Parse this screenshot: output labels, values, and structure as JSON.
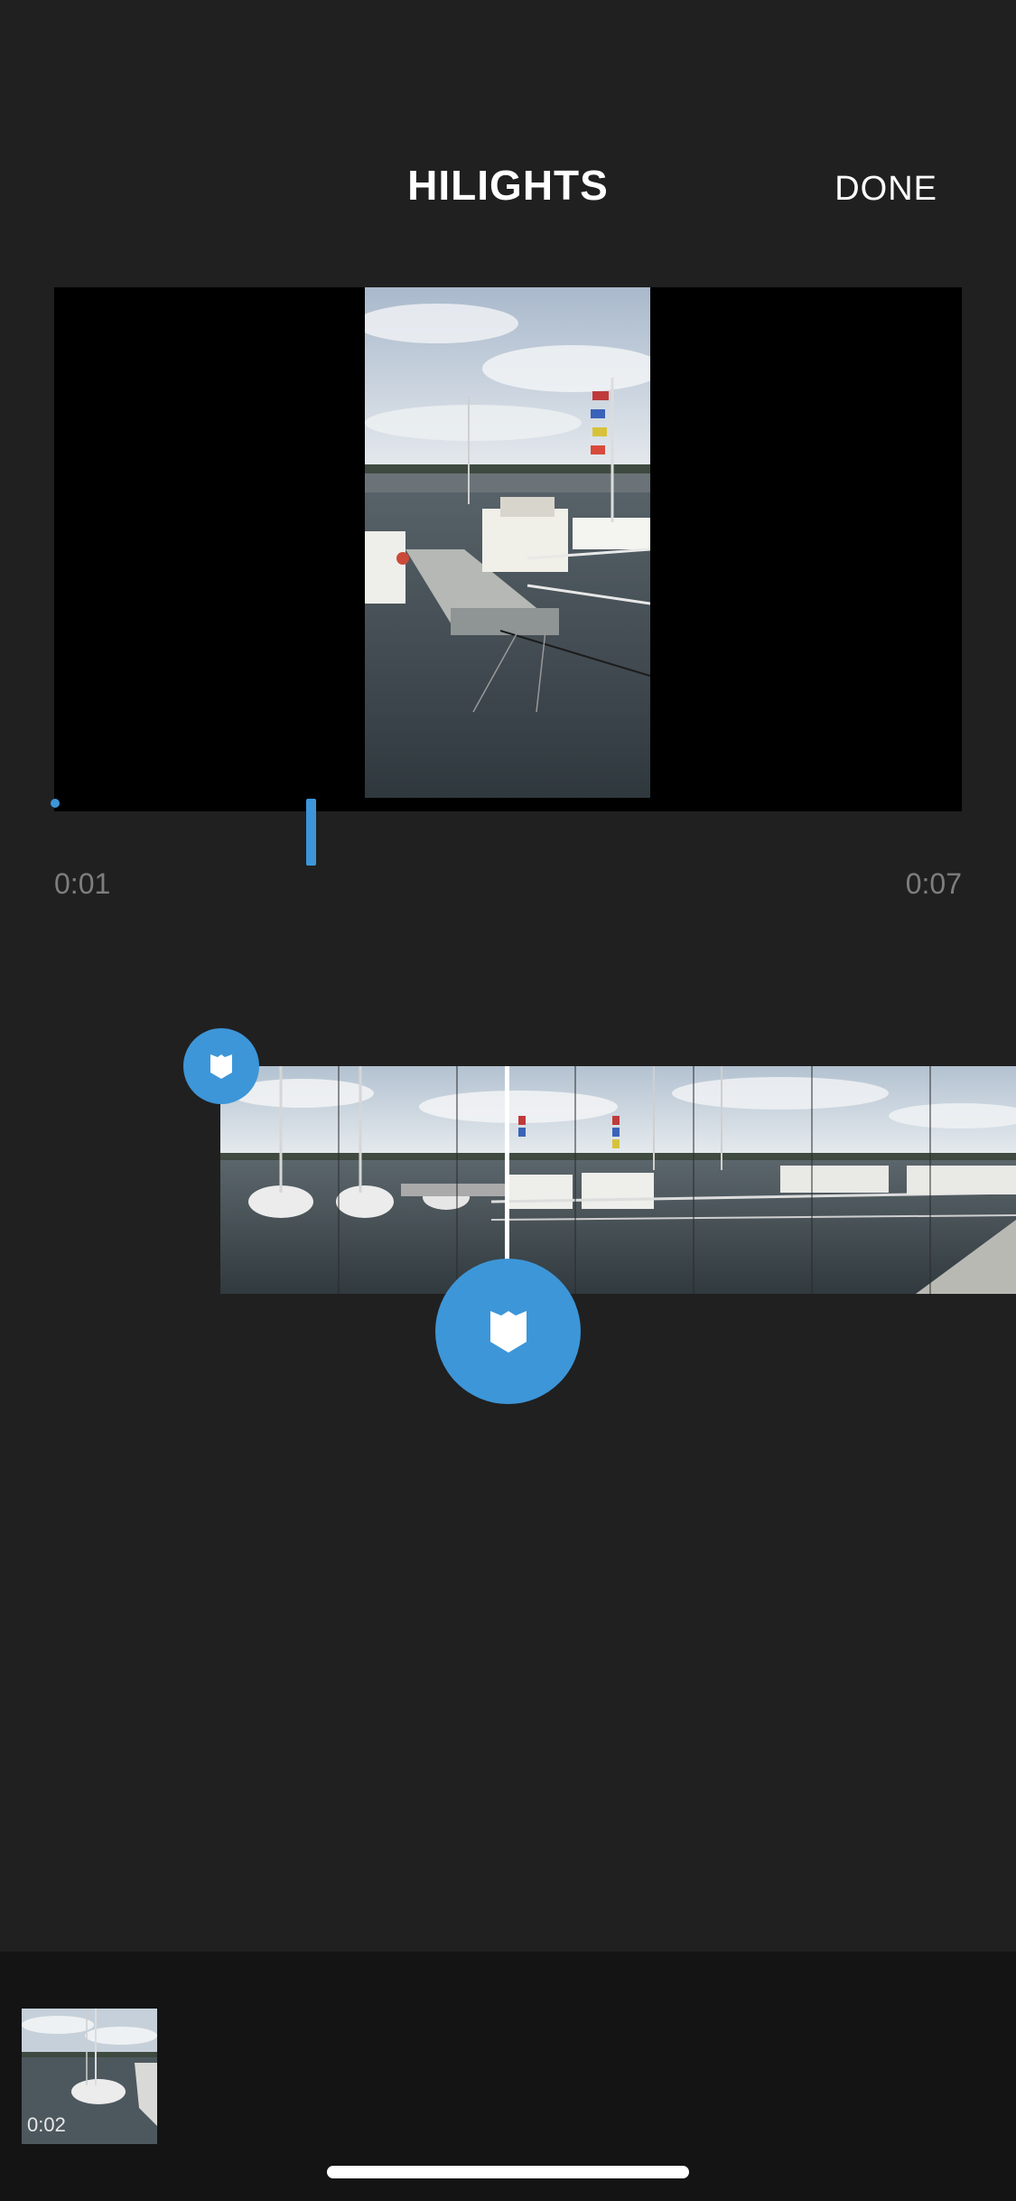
{
  "header": {
    "title": "HILIGHTS",
    "done_label": "DONE"
  },
  "scrubber": {
    "start_time": "0:01",
    "end_time": "0:07"
  },
  "icons": {
    "hilight_marker": "bookmark-shield-icon"
  },
  "tray": {
    "clips": [
      {
        "duration": "0:02"
      }
    ]
  },
  "colors": {
    "background": "#202020",
    "accent": "#3d96d8",
    "tray": "#141414",
    "time_text": "#7e7e7e"
  }
}
